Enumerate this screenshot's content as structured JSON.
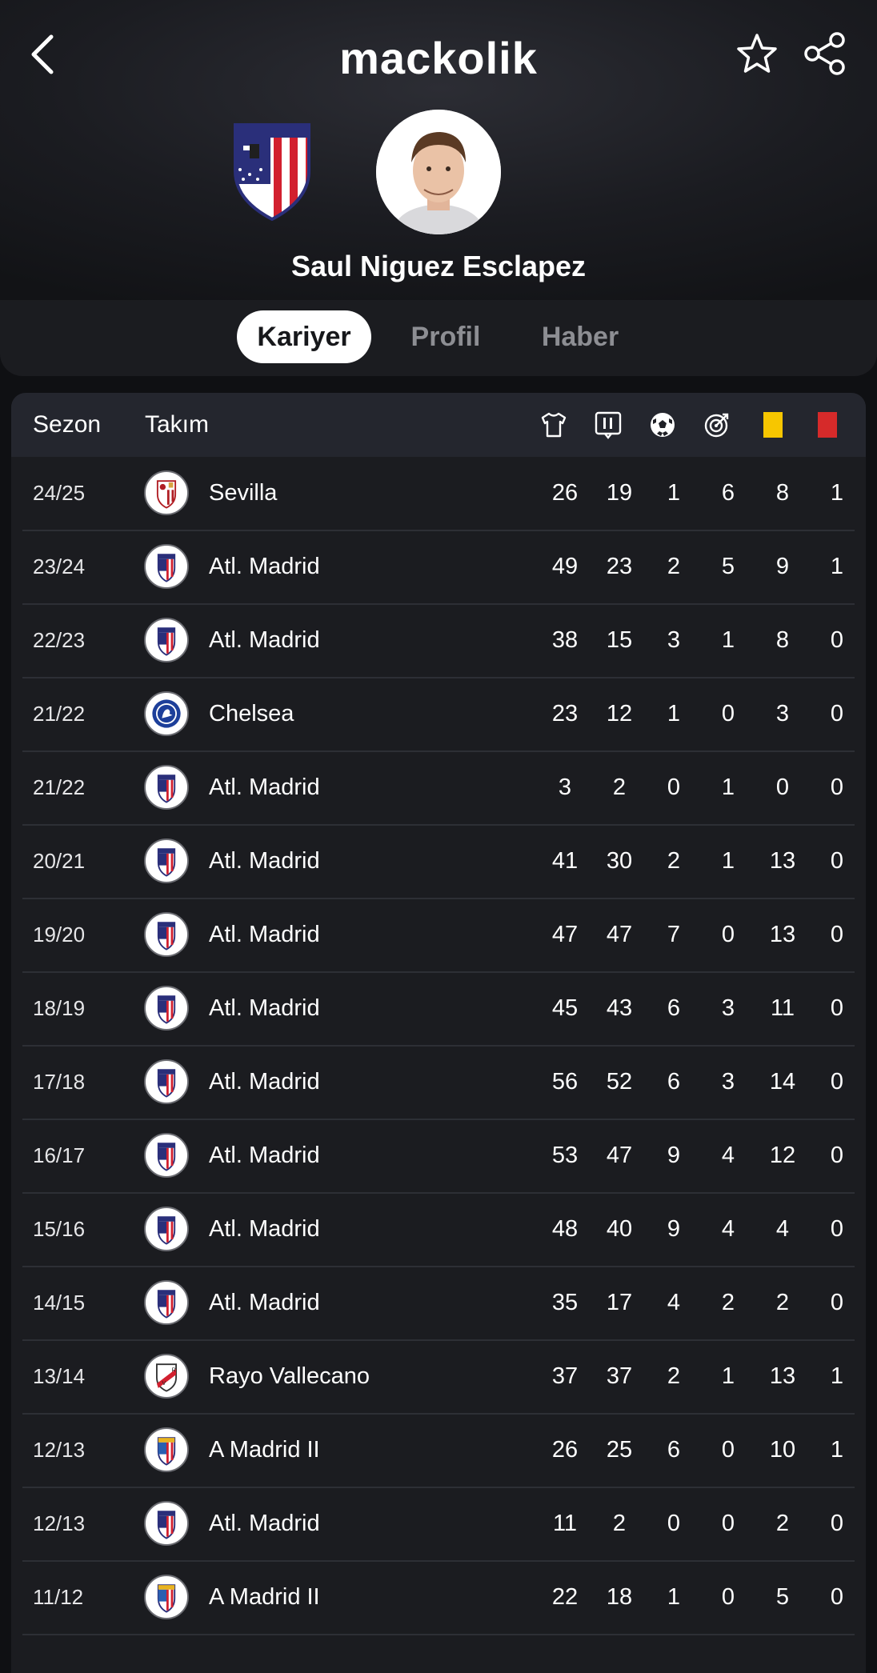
{
  "app": {
    "brand": "mackolik"
  },
  "icons": {
    "back": "chevron-left-icon",
    "favorite": "star-icon",
    "share": "share-icon"
  },
  "player": {
    "name": "Saul Niguez Esclapez",
    "team_crest": "atletico-madrid-crest"
  },
  "tabs": [
    {
      "label": "Kariyer",
      "active": true
    },
    {
      "label": "Profil",
      "active": false
    },
    {
      "label": "Haber",
      "active": false
    }
  ],
  "table": {
    "headers": {
      "season": "Sezon",
      "team": "Takım",
      "stat_icons": [
        "shirt-icon",
        "lineup-icon",
        "ball-icon",
        "target-icon",
        "yellow-card-icon",
        "red-card-icon"
      ]
    },
    "colors": {
      "yellow_card": "#f7c600",
      "red_card": "#d62a2a"
    },
    "rows": [
      {
        "season": "24/25",
        "team": "Sevilla",
        "logo": "sevilla",
        "stats": [
          "26",
          "19",
          "1",
          "6",
          "8",
          "1"
        ]
      },
      {
        "season": "23/24",
        "team": "Atl. Madrid",
        "logo": "atletico",
        "stats": [
          "49",
          "23",
          "2",
          "5",
          "9",
          "1"
        ]
      },
      {
        "season": "22/23",
        "team": "Atl. Madrid",
        "logo": "atletico",
        "stats": [
          "38",
          "15",
          "3",
          "1",
          "8",
          "0"
        ]
      },
      {
        "season": "21/22",
        "team": "Chelsea",
        "logo": "chelsea",
        "stats": [
          "23",
          "12",
          "1",
          "0",
          "3",
          "0"
        ]
      },
      {
        "season": "21/22",
        "team": "Atl. Madrid",
        "logo": "atletico",
        "stats": [
          "3",
          "2",
          "0",
          "1",
          "0",
          "0"
        ]
      },
      {
        "season": "20/21",
        "team": "Atl. Madrid",
        "logo": "atletico",
        "stats": [
          "41",
          "30",
          "2",
          "1",
          "13",
          "0"
        ]
      },
      {
        "season": "19/20",
        "team": "Atl. Madrid",
        "logo": "atletico",
        "stats": [
          "47",
          "47",
          "7",
          "0",
          "13",
          "0"
        ]
      },
      {
        "season": "18/19",
        "team": "Atl. Madrid",
        "logo": "atletico",
        "stats": [
          "45",
          "43",
          "6",
          "3",
          "11",
          "0"
        ]
      },
      {
        "season": "17/18",
        "team": "Atl. Madrid",
        "logo": "atletico",
        "stats": [
          "56",
          "52",
          "6",
          "3",
          "14",
          "0"
        ]
      },
      {
        "season": "16/17",
        "team": "Atl. Madrid",
        "logo": "atletico",
        "stats": [
          "53",
          "47",
          "9",
          "4",
          "12",
          "0"
        ]
      },
      {
        "season": "15/16",
        "team": "Atl. Madrid",
        "logo": "atletico",
        "stats": [
          "48",
          "40",
          "9",
          "4",
          "4",
          "0"
        ]
      },
      {
        "season": "14/15",
        "team": "Atl. Madrid",
        "logo": "atletico",
        "stats": [
          "35",
          "17",
          "4",
          "2",
          "2",
          "0"
        ]
      },
      {
        "season": "13/14",
        "team": "Rayo Vallecano",
        "logo": "rayo",
        "stats": [
          "37",
          "37",
          "2",
          "1",
          "13",
          "1"
        ]
      },
      {
        "season": "12/13",
        "team": "A Madrid II",
        "logo": "atletico-b",
        "stats": [
          "26",
          "25",
          "6",
          "0",
          "10",
          "1"
        ]
      },
      {
        "season": "12/13",
        "team": "Atl. Madrid",
        "logo": "atletico",
        "stats": [
          "11",
          "2",
          "0",
          "0",
          "2",
          "0"
        ]
      },
      {
        "season": "11/12",
        "team": "A Madrid II",
        "logo": "atletico-b",
        "stats": [
          "22",
          "18",
          "1",
          "0",
          "5",
          "0"
        ]
      }
    ]
  }
}
